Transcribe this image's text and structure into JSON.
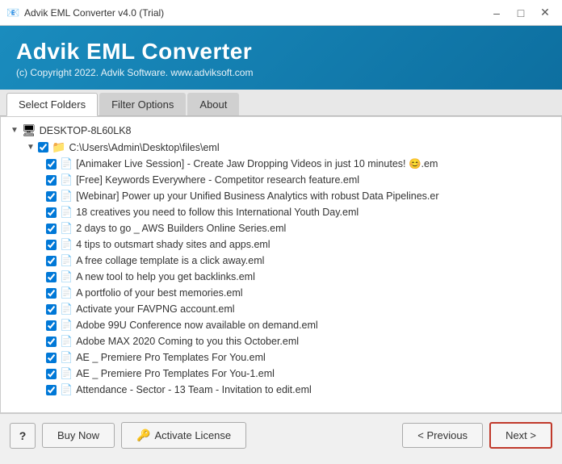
{
  "titleBar": {
    "icon": "📧",
    "title": "Advik EML Converter v4.0 (Trial)",
    "minimizeLabel": "–",
    "maximizeLabel": "□",
    "closeLabel": "✕"
  },
  "header": {
    "appTitle": "Advik EML Converter",
    "subtitle": "(c) Copyright 2022. Advik Software. www.adviksoft.com"
  },
  "tabs": [
    {
      "label": "Select Folders",
      "active": true
    },
    {
      "label": "Filter Options",
      "active": false
    },
    {
      "label": "About",
      "active": false
    }
  ],
  "tree": {
    "rootLabel": "DESKTOP-8L60LK8",
    "folderPath": "C:\\Users\\Admin\\Desktop\\files\\eml",
    "files": [
      "[Animaker Live Session] - Create Jaw Dropping Videos in just 10 minutes! 😊.em",
      "[Free] Keywords Everywhere - Competitor research feature.eml",
      "[Webinar] Power up your Unified Business Analytics with robust Data Pipelines.er",
      "18 creatives you need to follow this International Youth Day.eml",
      "2 days to go _ AWS Builders Online Series.eml",
      "4 tips to outsmart shady sites and apps.eml",
      "A free collage template is a click away.eml",
      "A new tool to help you get backlinks.eml",
      "A portfolio of your best memories.eml",
      "Activate your FAVPNG account.eml",
      "Adobe 99U Conference now available on demand.eml",
      "Adobe MAX 2020 Coming to you this October.eml",
      "AE _ Premiere Pro Templates For You.eml",
      "AE _ Premiere Pro Templates For You-1.eml",
      "Attendance - Sector - 13 Team - Invitation to edit.eml"
    ]
  },
  "footer": {
    "helpLabel": "?",
    "buyNowLabel": "Buy Now",
    "activateLicenseLabel": "Activate License",
    "previousLabel": "< Previous",
    "nextLabel": "Next >"
  }
}
